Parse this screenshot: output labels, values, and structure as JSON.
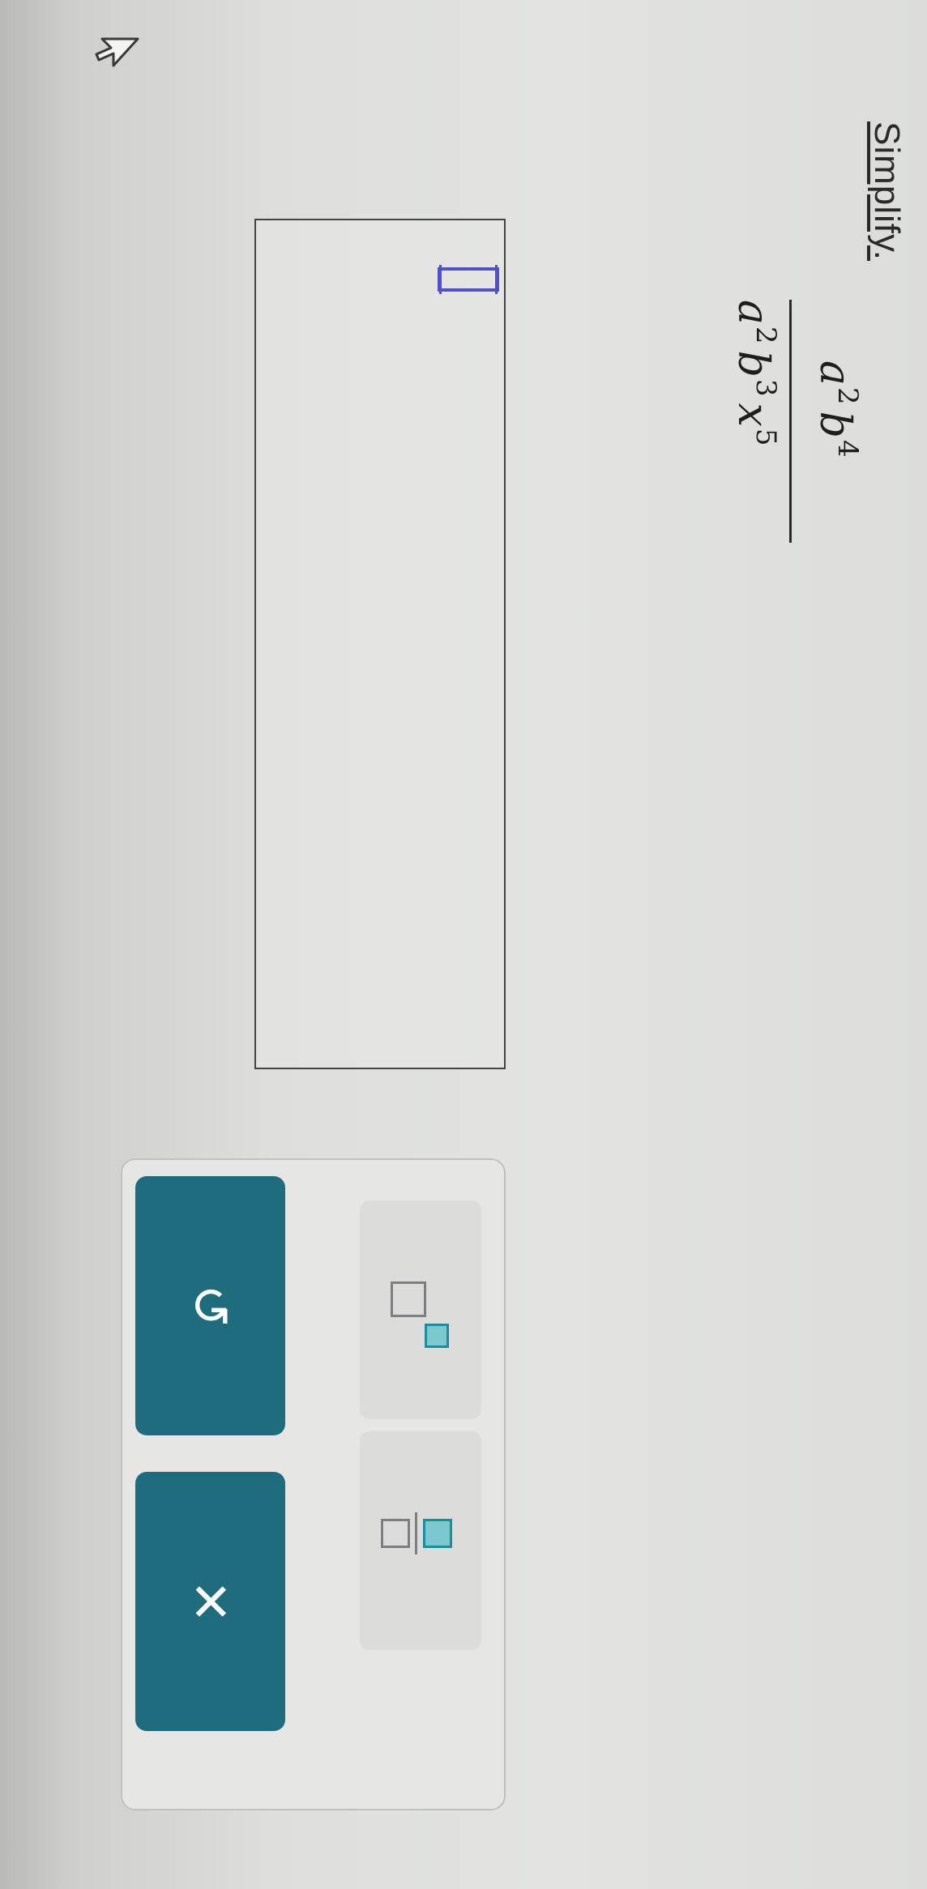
{
  "prompt": "Simplify.",
  "problem": {
    "numerator": {
      "base1": "a",
      "exp1": "2",
      "base2": "b",
      "exp2": "4"
    },
    "denominator": {
      "base1": "a",
      "exp1": "2",
      "base2": "b",
      "exp2": "3",
      "base3": "x",
      "exp3": "5"
    }
  },
  "answer": {
    "value": ""
  },
  "toolbar": {
    "keys": [
      {
        "icon": "exponent-template-icon"
      },
      {
        "icon": "fraction-template-icon"
      }
    ],
    "undo": {
      "icon": "undo-icon",
      "glyph": "↺"
    },
    "clear": {
      "icon": "close-icon",
      "glyph": "✕"
    }
  },
  "colors": {
    "button": "#1f6c7f",
    "cursor": "#4e52c9",
    "template_fill": "#7cc8cf"
  }
}
